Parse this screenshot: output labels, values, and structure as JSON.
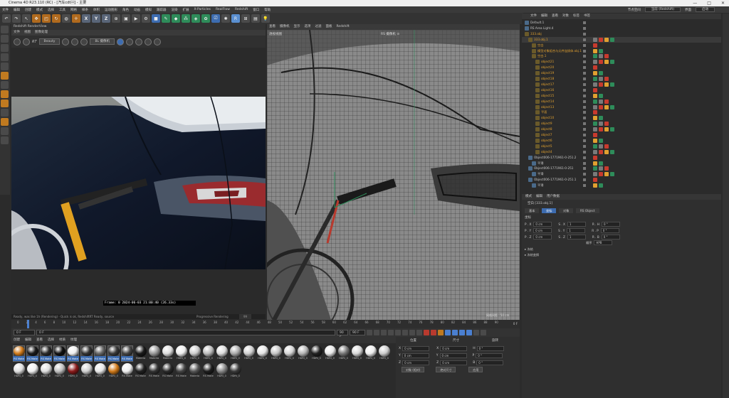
{
  "window": {
    "title": "Cinema 4D R23.110 (RC) - [汽车cdt\u0001] - 主要",
    "controls": [
      "—",
      "□",
      "✕"
    ]
  },
  "menubar": {
    "items": [
      "文件",
      "编辑",
      "创建",
      "模式",
      "选择",
      "工具",
      "网格",
      "样条",
      "体积",
      "运动图形",
      "角色",
      "动画",
      "模拟",
      "跟踪器",
      "渲染",
      "扩展",
      "X-Particles",
      "RealFlow",
      "Redshift",
      "窗口",
      "帮助"
    ],
    "node_space_label": "节点空间",
    "node_space_value": "当前 (Redshift)",
    "layout_label": "界面",
    "layout_value": "启动"
  },
  "toolbar": {
    "axis_x": "X",
    "axis_y": "Y",
    "axis_z": "Z"
  },
  "render_view": {
    "title": "Redshift RenderView",
    "menu": [
      "文件",
      "视图",
      "图像处理"
    ],
    "mode_select": "Beauty",
    "rt_label": "RT",
    "camera_select": "BL 摄像机",
    "frame_status": "Frame: 0    2024-06-03  21:00:40  (26.33s)",
    "status_text": "Ready, was like 1h (Rendering) - Quick is ok, RedshiftRT Ready, source",
    "progressive_label": "Progressive Rendering",
    "progressive_value": "99"
  },
  "viewport": {
    "menu": [
      "查看",
      "摄像机",
      "显示",
      "选项",
      "过滤",
      "面板",
      "Redshift"
    ],
    "view_label": "透视视图",
    "camera_label": "RS 摄像机 ⊙",
    "grid_label": "网格间距 : 50 cm"
  },
  "timeline": {
    "ticks": [
      "0",
      "2",
      "4",
      "6",
      "8",
      "10",
      "12",
      "14",
      "16",
      "18",
      "20",
      "22",
      "24",
      "26",
      "28",
      "30",
      "32",
      "34",
      "36",
      "38",
      "40",
      "42",
      "44",
      "46",
      "48",
      "50",
      "52",
      "54",
      "56",
      "58",
      "60",
      "62",
      "64",
      "66",
      "68",
      "70",
      "72",
      "74",
      "76",
      "78",
      "80",
      "82",
      "84",
      "86",
      "88",
      "90"
    ],
    "end_label": "0 F",
    "start_frame": "0 F",
    "current_frame": "0 F",
    "end_frame": "90 F",
    "end_frame2": "90 F"
  },
  "materials": {
    "menu": [
      "创建",
      "编辑",
      "查看",
      "选择",
      "材质",
      "纹理"
    ],
    "items": [
      {
        "label": "RS Mate",
        "color": "#d07a1a",
        "selected": true
      },
      {
        "label": "RS Mate",
        "color": "#1a1a1a",
        "selected": true
      },
      {
        "label": "RS Mate",
        "color": "#2a2a2a",
        "selected": true
      },
      {
        "label": "RS Mate",
        "color": "#111111",
        "selected": true
      },
      {
        "label": "RS Mate",
        "color": "#eeeeee",
        "selected": true
      },
      {
        "label": "RS Mate",
        "color": "#333333",
        "selected": true
      },
      {
        "label": "RS Mate",
        "color": "#666666",
        "selected": true
      },
      {
        "label": "RS Mate",
        "color": "#3a3a3a",
        "selected": true
      },
      {
        "label": "RS Mate",
        "color": "#444444",
        "selected": true
      },
      {
        "label": "Materia",
        "color": "#1a1a1a",
        "selected": false
      },
      {
        "label": "Materia",
        "color": "#999999",
        "selected": false
      },
      {
        "label": "Materia",
        "color": "#dddddd",
        "selected": false
      },
      {
        "label": "HDRI_0",
        "color": "#eeeeee",
        "selected": false
      },
      {
        "label": "HDRI_0",
        "color": "#cccccc",
        "selected": false
      },
      {
        "label": "HDRI_0",
        "color": "#bbbbbb",
        "selected": false
      },
      {
        "label": "HDRI_0",
        "color": "#dddddd",
        "selected": false
      },
      {
        "label": "HDRI_0",
        "color": "#aaaaaa",
        "selected": false
      },
      {
        "label": "HDRI_0",
        "color": "#cfcfcf",
        "selected": false
      },
      {
        "label": "HDRI_0",
        "color": "#e5e5e5",
        "selected": false
      },
      {
        "label": "HDRI_0",
        "color": "#c5c5c5",
        "selected": false
      },
      {
        "label": "HDRI_0",
        "color": "#d5d5d5",
        "selected": false
      },
      {
        "label": "HDRI_0",
        "color": "#b5b5b5",
        "selected": false
      },
      {
        "label": "HDRI_0",
        "color": "#222222",
        "selected": false
      },
      {
        "label": "HDRI_0",
        "color": "#e8e8e8",
        "selected": false
      },
      {
        "label": "HDRI_0",
        "color": "#777777",
        "selected": false
      },
      {
        "label": "HDRI_0",
        "color": "#d8d8d8",
        "selected": false
      },
      {
        "label": "HDRI_0",
        "color": "#eeeeee",
        "selected": false
      },
      {
        "label": "HDRI_0",
        "color": "#cccccc",
        "selected": false
      },
      {
        "label": "HDRI_0",
        "color": "#e0e0e0",
        "selected": false
      },
      {
        "label": "HDRI_0",
        "color": "#f0f0f0",
        "selected": false
      },
      {
        "label": "HDRI_0",
        "color": "#dddddd",
        "selected": false
      },
      {
        "label": "HDRI_0",
        "color": "#c0c0c0",
        "selected": false
      },
      {
        "label": "HDRI_0",
        "color": "#8a1a1a",
        "selected": false
      },
      {
        "label": "HDRI_0",
        "color": "#d0d0d0",
        "selected": false
      },
      {
        "label": "HDRI_0",
        "color": "#e8e8e8",
        "selected": false
      },
      {
        "label": "HDRI_0",
        "color": "#d07a1a",
        "selected": false
      },
      {
        "label": "RS Mate",
        "color": "#eeeeee",
        "selected": false
      },
      {
        "label": "RS Mate",
        "color": "#222222",
        "selected": false
      },
      {
        "label": "RS Mate",
        "color": "#333333",
        "selected": false
      },
      {
        "label": "RS Mate",
        "color": "#2a2a2a",
        "selected": false
      },
      {
        "label": "RS Mate",
        "color": "#444444",
        "selected": false
      },
      {
        "label": "Materia",
        "color": "#555555",
        "selected": false
      },
      {
        "label": "RS Mate",
        "color": "#1e1e1e",
        "selected": false
      },
      {
        "label": "HDRI_0",
        "color": "#888888",
        "selected": false
      },
      {
        "label": "HDRI_0",
        "color": "#3a3a3a",
        "selected": false
      }
    ]
  },
  "coordinates": {
    "headers": [
      "位置",
      "尺寸",
      "旋转"
    ],
    "rows": [
      {
        "axis": "X",
        "pos": "0 cm",
        "size": "0 cm",
        "rot_axis": "H",
        "rot": "0 °"
      },
      {
        "axis": "Y",
        "pos": "0 cm",
        "size": "0 cm",
        "rot_axis": "P",
        "rot": "0 °"
      },
      {
        "axis": "Z",
        "pos": "0 cm",
        "size": "0 cm",
        "rot_axis": "B",
        "rot": "0 °"
      }
    ],
    "mode_select": "对象 (相对)",
    "size_select": "绝对尺寸",
    "apply_button": "应用"
  },
  "object_manager": {
    "menu": [
      "文件",
      "编辑",
      "查看",
      "对象",
      "标签",
      "书签"
    ],
    "objects": [
      {
        "name": "Default.1",
        "indent": 0,
        "color": "#c8c8c8"
      },
      {
        "name": "RS Area Light.4",
        "indent": 0,
        "color": "#c8c8c8"
      },
      {
        "name": "333.obj",
        "indent": 0,
        "color": "#e0a030"
      },
      {
        "name": "333.obj.1",
        "indent": 1,
        "color": "#e0a030"
      },
      {
        "name": "空白",
        "indent": 2,
        "color": "#e0a030"
      },
      {
        "name": "模型对象组合与元件连接体.obj.1",
        "indent": 2,
        "color": "#e0a030"
      },
      {
        "name": "空白.1",
        "indent": 2,
        "color": "#e0a030"
      },
      {
        "name": "object21",
        "indent": 3,
        "color": "#e0a030"
      },
      {
        "name": "object20",
        "indent": 3,
        "color": "#e0a030"
      },
      {
        "name": "object19",
        "indent": 3,
        "color": "#e0a030"
      },
      {
        "name": "object18",
        "indent": 3,
        "color": "#e0a030"
      },
      {
        "name": "object17",
        "indent": 3,
        "color": "#e0a030"
      },
      {
        "name": "object16",
        "indent": 3,
        "color": "#e0a030"
      },
      {
        "name": "object15",
        "indent": 3,
        "color": "#e0a030"
      },
      {
        "name": "object14",
        "indent": 3,
        "color": "#e0a030"
      },
      {
        "name": "object13",
        "indent": 3,
        "color": "#e0a030"
      },
      {
        "name": "平面",
        "indent": 3,
        "color": "#e0a030"
      },
      {
        "name": "object10",
        "indent": 3,
        "color": "#e0a030"
      },
      {
        "name": "object9",
        "indent": 3,
        "color": "#e0a030"
      },
      {
        "name": "object8",
        "indent": 3,
        "color": "#e0a030"
      },
      {
        "name": "object7",
        "indent": 3,
        "color": "#e0a030"
      },
      {
        "name": "object6",
        "indent": 3,
        "color": "#e0a030"
      },
      {
        "name": "object5",
        "indent": 3,
        "color": "#e0a030"
      },
      {
        "name": "object4",
        "indent": 3,
        "color": "#e0a030"
      },
      {
        "name": "Object006-1771961-0-251.2",
        "indent": 1,
        "color": "#c8c8c8"
      },
      {
        "name": "平滑",
        "indent": 2,
        "color": "#c8c8c8"
      },
      {
        "name": "Object006-1771961-0-251",
        "indent": 1,
        "color": "#c8c8c8"
      },
      {
        "name": "平滑",
        "indent": 2,
        "color": "#c8c8c8"
      },
      {
        "name": "Object006-1771961-0-251.1",
        "indent": 1,
        "color": "#c8c8c8"
      },
      {
        "name": "平滑",
        "indent": 2,
        "color": "#c8c8c8"
      }
    ]
  },
  "attributes": {
    "menu": [
      "模式",
      "编辑",
      "用户数据"
    ],
    "object_label": "空白 [333.obj.1]",
    "tabs": [
      "基本",
      "坐标",
      "对象",
      "RS Object"
    ],
    "active_tab": "坐标",
    "section_title": "坐标",
    "rows": [
      {
        "a": "P . X",
        "av": "0 cm",
        "b": "S . X",
        "bv": "1",
        "c": "R . H",
        "cv": "0 °"
      },
      {
        "a": "P . Y",
        "av": "0 cm",
        "b": "S . Y",
        "bv": "1",
        "c": "R . P",
        "cv": "0 °"
      },
      {
        "a": "P . Z",
        "av": "0 cm",
        "b": "S . Z",
        "bv": "1",
        "c": "R . B",
        "cv": "0 °"
      }
    ],
    "order_label": "顺序",
    "order_value": "HPB",
    "freeze_label": "▸ 冻结",
    "freeze2_label": "▸ 冻结变换"
  }
}
